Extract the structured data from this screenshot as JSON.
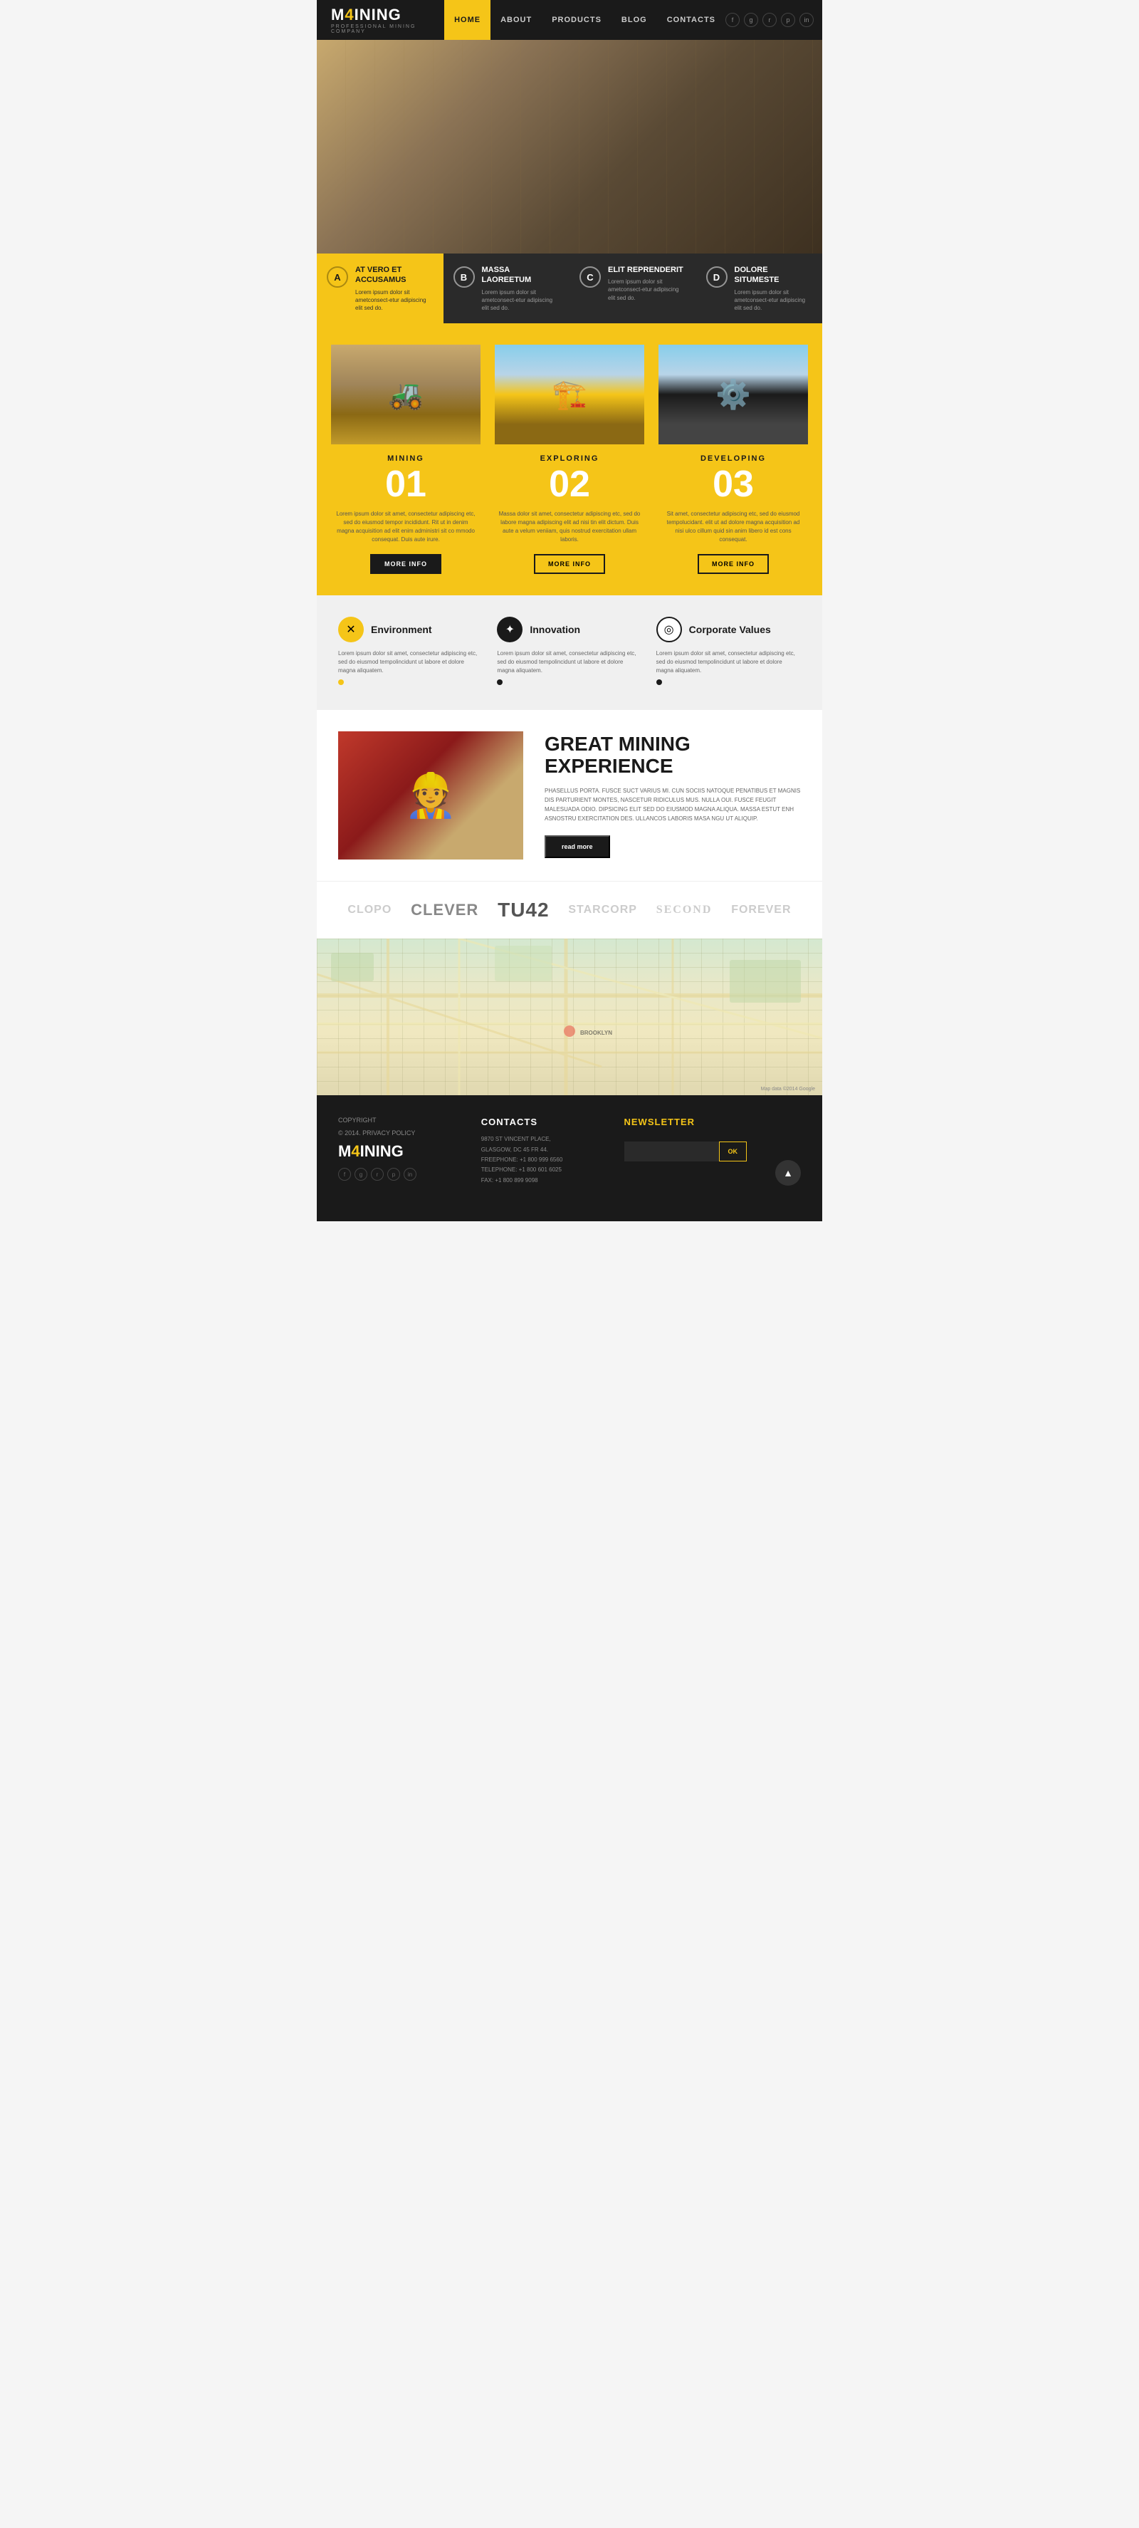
{
  "header": {
    "logo": "M4INING",
    "logo_highlight": "4",
    "logo_sub": "PROFESSIONAL MINING COMPANY",
    "nav": [
      {
        "label": "HOME",
        "active": true
      },
      {
        "label": "ABOUT",
        "active": false
      },
      {
        "label": "PRODUCTS",
        "active": false
      },
      {
        "label": "BLOG",
        "active": false
      },
      {
        "label": "CONTACTS",
        "active": false
      }
    ],
    "social_icons": [
      "f",
      "g+",
      "rss",
      "p",
      "in"
    ]
  },
  "hero_boxes": [
    {
      "letter": "A",
      "title": "AT VERO ET ACCUSAMUS",
      "desc": "Lorem ipsum dolor sit ametconsect-etur adipiscing elit sed do.",
      "style": "yellow"
    },
    {
      "letter": "B",
      "title": "MASSA LAOREETUM",
      "desc": "Lorem ipsum dolor sit ametconsect-etur adipiscing elit sed do.",
      "style": "dark"
    },
    {
      "letter": "C",
      "title": "ELIT REPRENDERIT",
      "desc": "Lorem ipsum dolor sit ametconsect-etur adipiscing elit sed do.",
      "style": "dark"
    },
    {
      "letter": "D",
      "title": "DOLORE SITUMESTE",
      "desc": "Lorem ipsum dolor sit ametconsect-etur adipiscing elit sed do.",
      "style": "dark"
    }
  ],
  "services": [
    {
      "title": "MINING",
      "number": "01",
      "desc": "Lorem ipsum dolor sit amet, consectetur adipiscing etc, sed do eiusmod tempor incididunt. Rit ut in denim magna acquisition ad elit enim administri sit co mmodo consequat. Duis aute irure.",
      "btn": "more info"
    },
    {
      "title": "EXPLORING",
      "number": "02",
      "desc": "Massa dolor sit amet, consectetur adipiscing etc, sed do labore magna adipiscing elit ad nisi tin elit dictum. Duis aute a velum veniiam, quis nostrud exercitation ullam laboris.",
      "btn": "more info"
    },
    {
      "title": "DEVELOPING",
      "number": "03",
      "desc": "Sit amet, consectetur adipiscing etc, sed do eiusmod tempolucidant. elit ut ad dolore magna acquisition ad nisi ulco cillum quid sin anim libero id est cons consequat.",
      "btn": "more info"
    }
  ],
  "features": [
    {
      "icon": "✕",
      "icon_style": "yellow",
      "title": "Environment",
      "desc": "Lorem ipsum dolor sit amet, consectetur adipiscing etc, sed do eiusmod tempolincidunt ut labore et dolore magna aliquatem.",
      "dot": "yellow"
    },
    {
      "icon": "✦",
      "icon_style": "dark",
      "title": "Innovation",
      "desc": "Lorem ipsum dolor sit amet, consectetur adipiscing etc, sed do eiusmod tempolincidunt ut labore et dolore magna aliquatem.",
      "dot": "dark"
    },
    {
      "icon": "◎",
      "icon_style": "outline",
      "title": "Corporate Values",
      "desc": "Lorem ipsum dolor sit amet, consectetur adipiscing etc, sed do eiusmod tempolincidunt ut labore et dolore magna aliquatem.",
      "dot": "dark"
    }
  ],
  "experience": {
    "title": "GREAT MINING EXPERIENCE",
    "desc": "PHASELLUS PORTA. FUSCE SUCT VARIUS MI. CUN SOCIIS NATOQUE PENATIBUS ET MAGNIS DIS PARTURIENT MONTES, NASCETUR RIDICULUS MUS. NULLA OUI. FUSCE FEUGIT MALESUADA ODIO. DIPSICING ELIT SED DO EIUSMOD MAGNA ALIQUA. MASSA ESTUT ENH ASNOSTRU EXERCITATION DES. ULLANCOS LABORIS MASA NGU UT ALIQUIP.",
    "btn": "read more"
  },
  "partners": [
    {
      "name": "CLOPO",
      "style": "normal"
    },
    {
      "name": "CLEVER",
      "style": "bold"
    },
    {
      "name": "TU42",
      "style": "large"
    },
    {
      "name": "STARCORP",
      "style": "normal"
    },
    {
      "name": "SECOND",
      "style": "serif"
    },
    {
      "name": "FOREVER",
      "style": "normal"
    }
  ],
  "footer": {
    "copyright": "COPYRIGHT",
    "year": "© 2014. PRIVACY POLICY",
    "logo": "M4INING",
    "logo_highlight": "4",
    "contacts_title": "CONTACTS",
    "address_lines": [
      "9870 ST VINCENT PLACE,",
      "GLASGOW, DC 45 FR 44.",
      "FREEPHONE: +1 800 999 6560",
      "TELEPHONE: +1 800 601 6025",
      "FAX: +1 800 899 9098"
    ],
    "newsletter_title": "NEWSLETTER",
    "newsletter_placeholder": "",
    "newsletter_btn": "OK"
  }
}
